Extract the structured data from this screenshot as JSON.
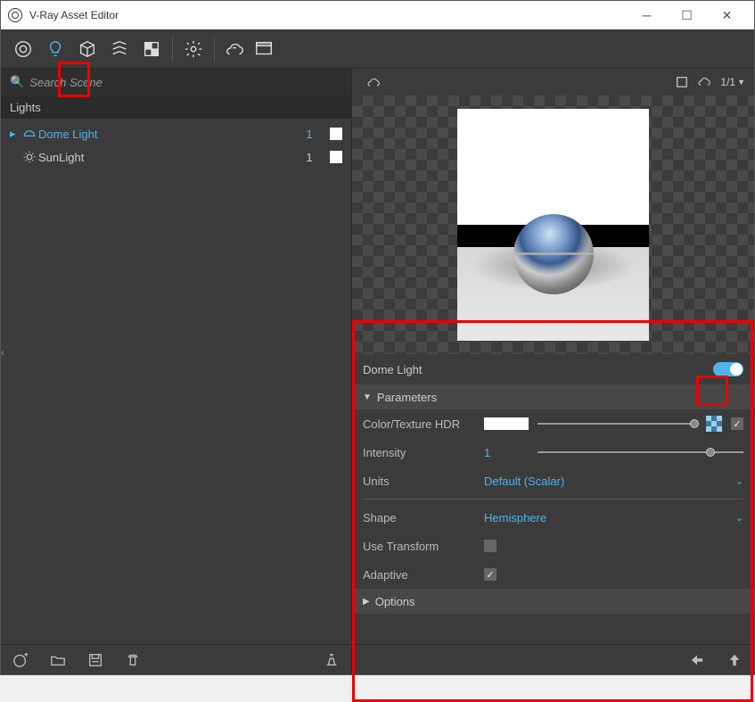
{
  "window": {
    "title": "V-Ray Asset Editor"
  },
  "search": {
    "placeholder": "Search Scene"
  },
  "left": {
    "header": "Lights",
    "items": [
      {
        "label": "Dome Light",
        "count": "1",
        "selected": true
      },
      {
        "label": "SunLight",
        "count": "1",
        "selected": false
      }
    ]
  },
  "preview": {
    "counter": "1/1"
  },
  "props": {
    "title": "Dome Light",
    "enabled": true,
    "section_parameters": "Parameters",
    "section_options": "Options",
    "color_label": "Color/Texture HDR",
    "intensity_label": "Intensity",
    "intensity_value": "1",
    "units_label": "Units",
    "units_value": "Default (Scalar)",
    "shape_label": "Shape",
    "shape_value": "Hemisphere",
    "use_transform_label": "Use Transform",
    "use_transform_checked": false,
    "adaptive_label": "Adaptive",
    "adaptive_checked": true
  }
}
